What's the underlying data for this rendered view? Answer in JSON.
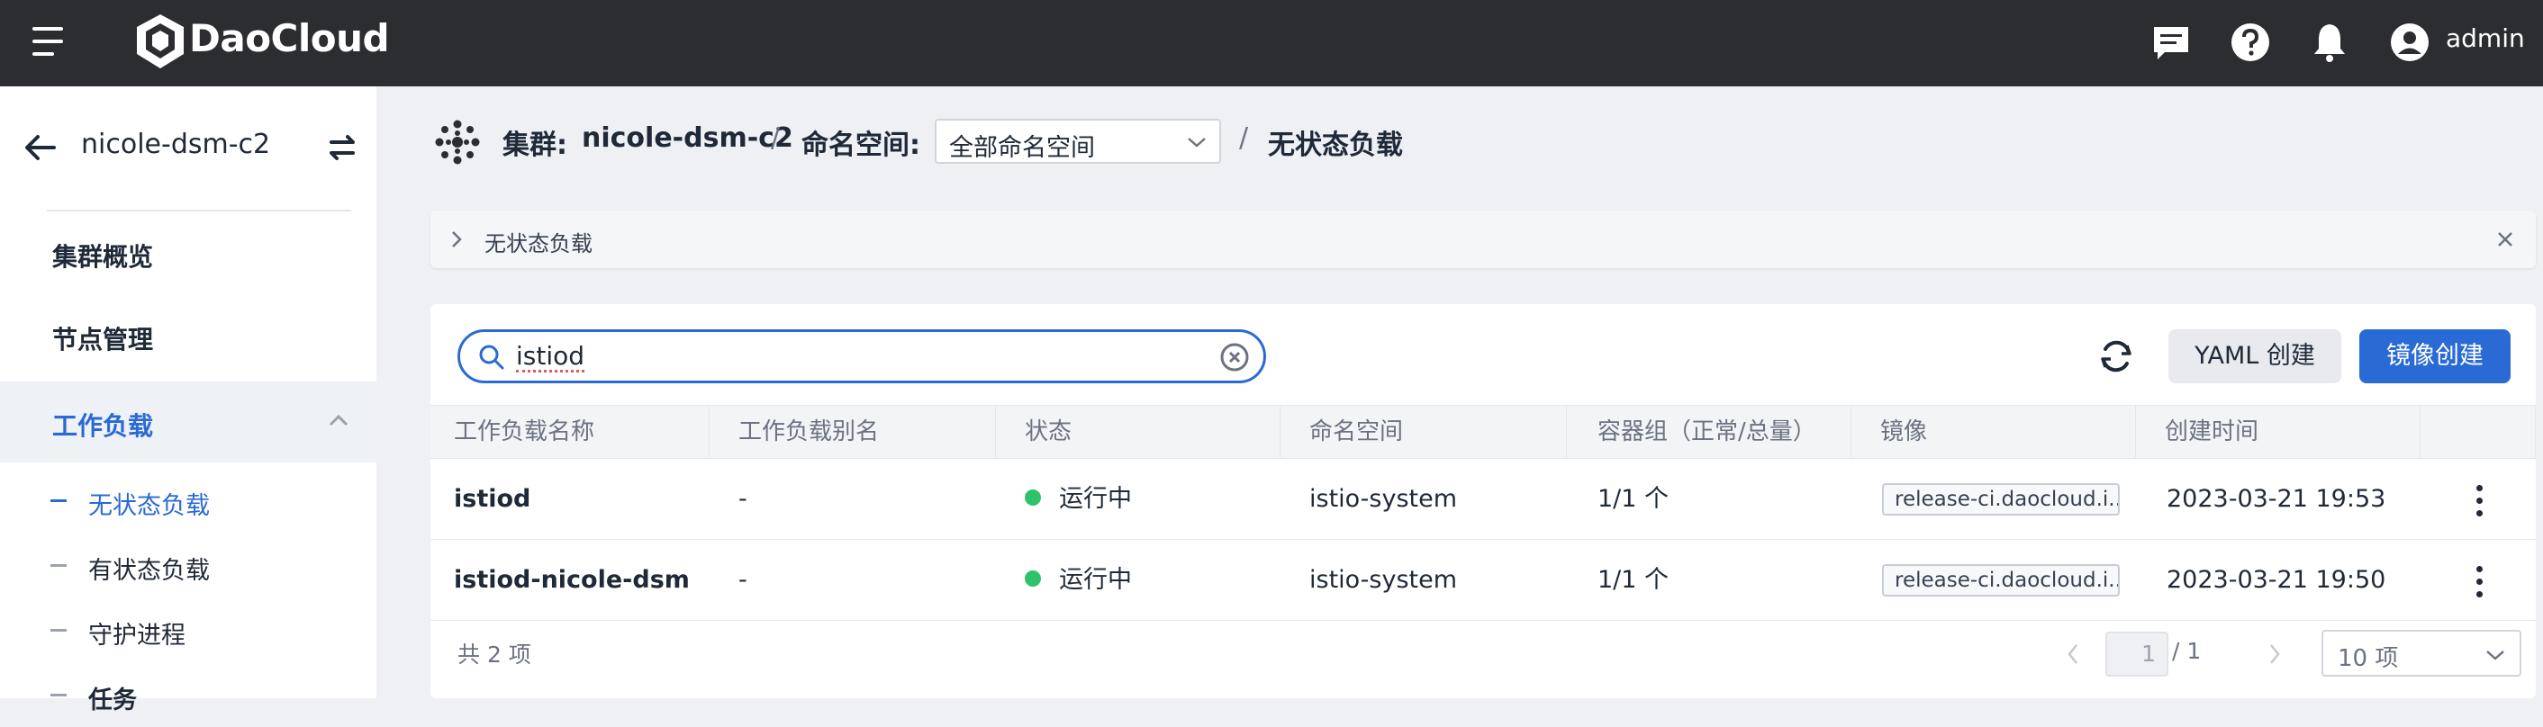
{
  "topbar": {
    "brand": "DaoCloud",
    "user": "admin",
    "icons": [
      "menu-icon",
      "daocloud-logo",
      "message-icon",
      "help-icon",
      "notification-bell-icon",
      "user-avatar-icon"
    ]
  },
  "sidebar": {
    "cluster_name": "nicole-dsm-c2",
    "items": [
      {
        "label": "集群概览"
      },
      {
        "label": "节点管理"
      },
      {
        "label": "工作负载"
      }
    ],
    "sub_items": [
      {
        "label": "无状态负载"
      },
      {
        "label": "有状态负载"
      },
      {
        "label": "守护进程"
      },
      {
        "label": "任务"
      }
    ]
  },
  "breadcrumb": {
    "cluster_label": "集群:",
    "cluster_value": "nicole-dsm-c2",
    "separator": "/",
    "namespace_label": "命名空间:",
    "namespace_value": "全部命名空间",
    "current": "无状态负载"
  },
  "banner": {
    "text": "无状态负载"
  },
  "toolbar": {
    "search_value": "istiod",
    "yaml_create": "YAML 创建",
    "image_create": "镜像创建"
  },
  "table": {
    "columns": [
      "工作负载名称",
      "工作负载别名",
      "状态",
      "命名空间",
      "容器组（正常/总量）",
      "镜像",
      "创建时间"
    ],
    "rows": [
      {
        "name": "istiod",
        "alias": "-",
        "status": "运行中",
        "namespace": "istio-system",
        "pods": "1/1 个",
        "image": "release-ci.daocloud.i...",
        "created": "2023-03-21 19:53"
      },
      {
        "name": "istiod-nicole-dsm-...",
        "alias": "-",
        "status": "运行中",
        "namespace": "istio-system",
        "pods": "1/1 个",
        "image": "release-ci.daocloud.i...",
        "created": "2023-03-21 19:50"
      }
    ]
  },
  "pagination": {
    "total": "共 2 项",
    "page": "1",
    "page_total": "/ 1",
    "page_size": "10 项"
  },
  "colors": {
    "accent": "#2a6ad4",
    "topbar": "#2b2d31",
    "running": "#2ec26a"
  }
}
